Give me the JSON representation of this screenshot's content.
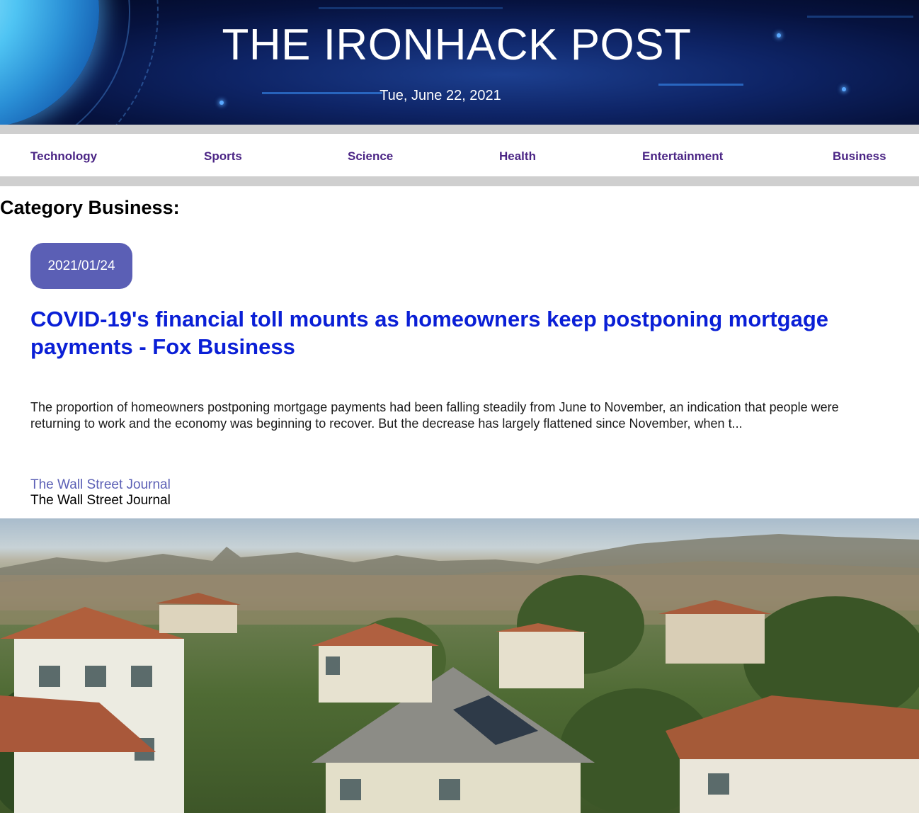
{
  "header": {
    "title": "THE IRONHACK POST",
    "date": "Tue, June 22, 2021"
  },
  "nav": {
    "items": [
      {
        "label": "Technology"
      },
      {
        "label": "Sports"
      },
      {
        "label": "Science"
      },
      {
        "label": "Health"
      },
      {
        "label": "Entertainment"
      },
      {
        "label": "Business"
      }
    ]
  },
  "main": {
    "category_heading": "Category Business:",
    "article": {
      "date": "2021/01/24",
      "headline": "COVID-19's financial toll mounts as homeowners keep postponing mortgage payments - Fox Business",
      "summary": "The proportion of homeowners postponing mortgage payments had been falling steadily from June to November, an indication that people were returning to work and the economy was beginning to recover. But the decrease has largely flattened since November, when t...",
      "source_link": "The Wall Street Journal",
      "source_name": "The Wall Street Journal"
    }
  },
  "colors": {
    "nav_link": "#4b2585",
    "headline": "#0a1fd6",
    "badge": "#5b5fb5",
    "source_link": "#5b5fb5"
  }
}
